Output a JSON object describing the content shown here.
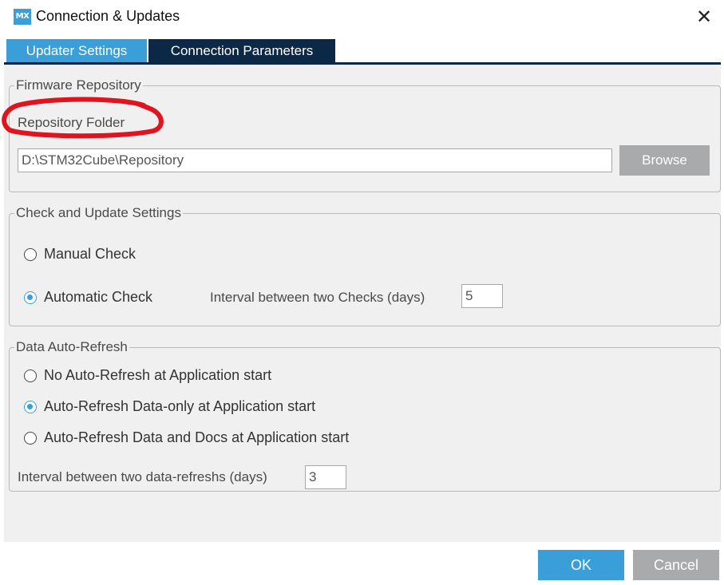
{
  "window": {
    "logo": "MX",
    "title": "Connection & Updates",
    "close_icon": "close-icon"
  },
  "tabs": [
    {
      "label": "Updater Settings",
      "active": true
    },
    {
      "label": "Connection Parameters",
      "active": false
    }
  ],
  "firmware_repository": {
    "legend": "Firmware Repository",
    "folder_label": "Repository Folder",
    "folder_value": "D:\\STM32Cube\\Repository",
    "browse_label": "Browse"
  },
  "check_update": {
    "legend": "Check and Update Settings",
    "manual_label": "Manual Check",
    "automatic_label": "Automatic Check",
    "selected": "Automatic Check",
    "interval_label": "Interval between two Checks (days)",
    "interval_value": "5"
  },
  "data_refresh": {
    "legend": "Data Auto-Refresh",
    "options": [
      {
        "label": "No Auto-Refresh at Application start",
        "checked": false
      },
      {
        "label": "Auto-Refresh Data-only at Application start",
        "checked": true
      },
      {
        "label": "Auto-Refresh Data and Docs at Application start",
        "checked": false
      }
    ],
    "interval_label": "Interval between two data-refreshs (days)",
    "interval_value": "3"
  },
  "footer": {
    "ok_label": "OK",
    "cancel_label": "Cancel"
  },
  "colors": {
    "accent": "#3a9fd8",
    "tab_dark": "#0b2847",
    "panel_bg": "#f0f0f0",
    "button_gray": "#a9aaac",
    "annotation": "#e0141e"
  }
}
